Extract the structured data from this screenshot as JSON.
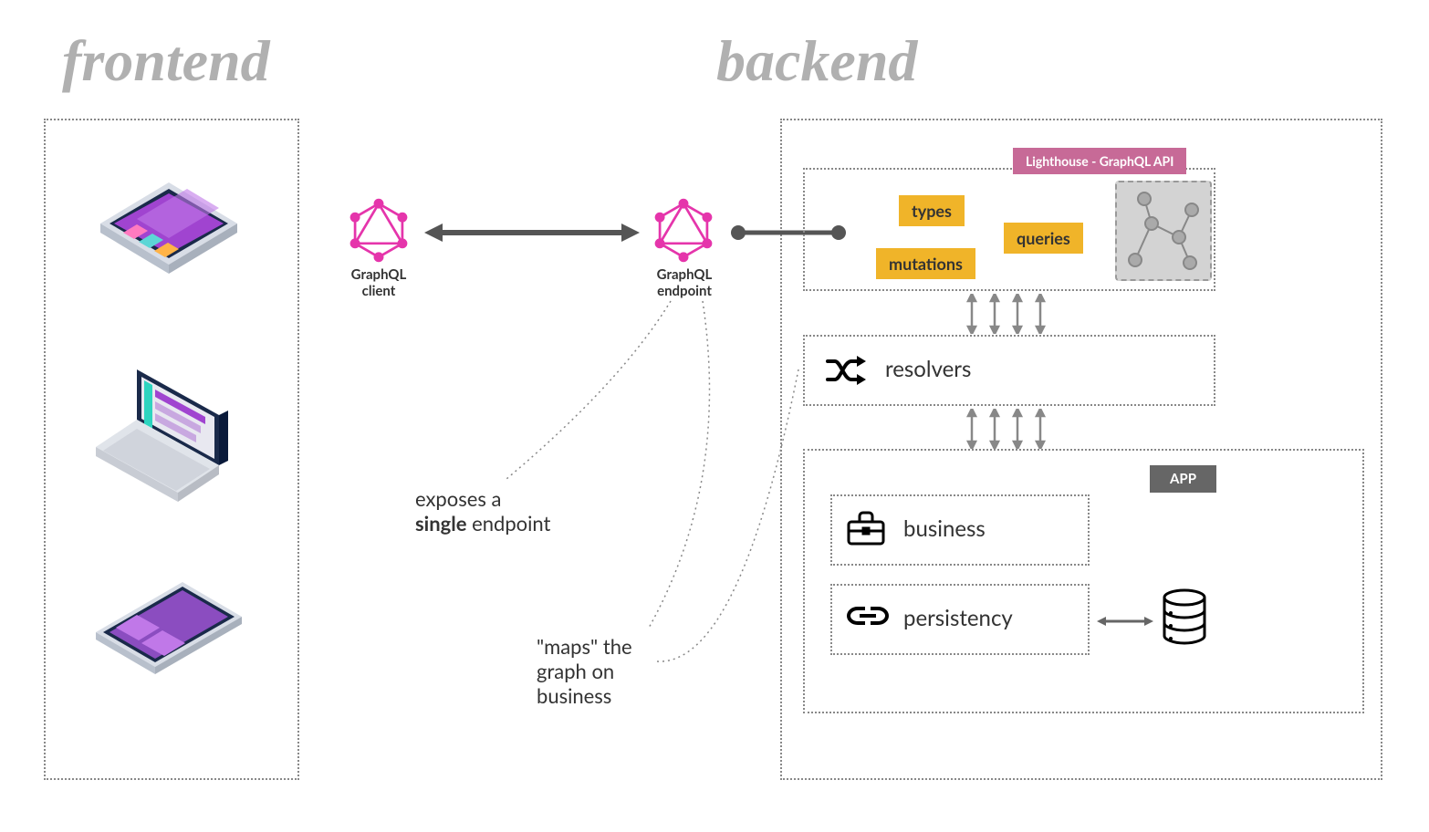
{
  "titles": {
    "frontend": "frontend",
    "backend": "backend"
  },
  "labels": {
    "lighthouse": "Lighthouse - GraphQL API",
    "app": "APP",
    "types": "types",
    "queries": "queries",
    "mutations": "mutations",
    "resolvers": "resolvers",
    "business": "business",
    "persistency": "persistency",
    "graphql_client": "GraphQL client",
    "graphql_endpoint": "GraphQL endpoint"
  },
  "annotations": {
    "exposes_prefix": "exposes a ",
    "exposes_bold": "single",
    "exposes_suffix": " endpoint",
    "maps": "\"maps\" the graph on business"
  },
  "colors": {
    "graphql_pink": "#e535ab",
    "tag_yellow": "#f0b429",
    "lighthouse_pink": "#c76a97",
    "app_gray": "#666666",
    "device_purple": "#7b3fb5",
    "device_navy": "#1a2a4a",
    "title_gray": "#b0b0b0"
  }
}
